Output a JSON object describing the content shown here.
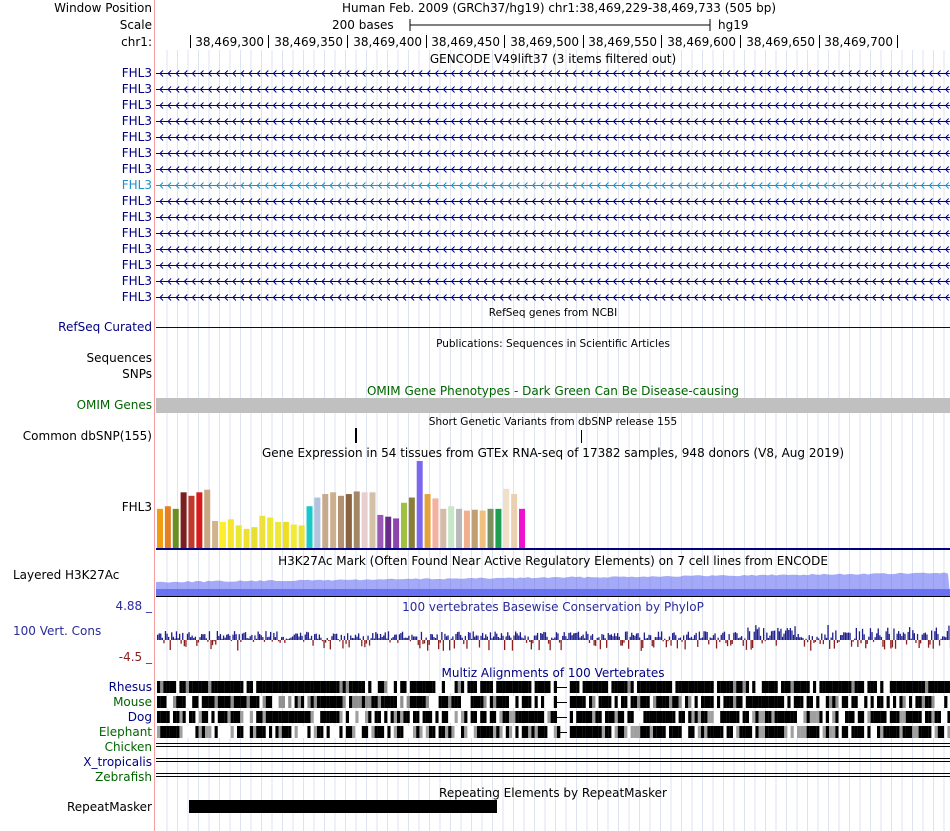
{
  "header": {
    "window_position_label": "Window Position",
    "scale_label": "Scale",
    "chrom_label": "chr1:",
    "assembly_text": "Human Feb. 2009 (GRCh37/hg19)   chr1:38,469,229-38,469,733 (505 bp)",
    "scale_text": "200 bases",
    "db": "hg19",
    "ticks": [
      "38,469,300",
      "38,469,350",
      "38,469,400",
      "38,469,450",
      "38,469,500",
      "38,469,550",
      "38,469,600",
      "38,469,650",
      "38,469,700"
    ]
  },
  "gencode": {
    "title": "GENCODE V49lift37 (3 items filtered out)",
    "gene_name": "FHL3",
    "rows": [
      {
        "name": "FHL3",
        "color": "#000080"
      },
      {
        "name": "FHL3",
        "color": "#000080"
      },
      {
        "name": "FHL3",
        "color": "#000080"
      },
      {
        "name": "FHL3",
        "color": "#000080"
      },
      {
        "name": "FHL3",
        "color": "#000080"
      },
      {
        "name": "FHL3",
        "color": "#000080"
      },
      {
        "name": "FHL3",
        "color": "#000080"
      },
      {
        "name": "FHL3",
        "color": "#1e90c8"
      },
      {
        "name": "FHL3",
        "color": "#000080"
      },
      {
        "name": "FHL3",
        "color": "#000080"
      },
      {
        "name": "FHL3",
        "color": "#000080"
      },
      {
        "name": "FHL3",
        "color": "#000080"
      },
      {
        "name": "FHL3",
        "color": "#000080"
      },
      {
        "name": "FHL3",
        "color": "#000080"
      },
      {
        "name": "FHL3",
        "color": "#000080"
      }
    ]
  },
  "refseq": {
    "title": "RefSeq genes from NCBI",
    "label": "RefSeq Curated"
  },
  "publications": {
    "title": "Publications: Sequences in Scientific Articles",
    "label_sequences": "Sequences",
    "label_snps": "SNPs"
  },
  "omim": {
    "title": "OMIM Gene Phenotypes - Dark Green Can Be Disease-causing",
    "label": "OMIM Genes",
    "color": "#006400"
  },
  "dbsnp": {
    "title": "Short Genetic Variants from dbSNP release 155",
    "label": "Common dbSNP(155)"
  },
  "gtex": {
    "title": "Gene Expression in 54 tissues from GTEx RNA-seq of 17382 samples, 948 donors (V8, Aug 2019)",
    "label": "FHL3",
    "colors": [
      "#f39c12",
      "#e67e22",
      "#6b8e23",
      "#7b1e1e",
      "#c0392b",
      "#d71a1a",
      "#c8a882",
      "#d2b48c",
      "#ffef2b",
      "#f5e52b",
      "#e8e830",
      "#f0e030",
      "#e8e030",
      "#eee040",
      "#ede830",
      "#f0e838",
      "#eedd20",
      "#f2ea38",
      "#ebe438",
      "#19c8c8",
      "#b0c4de",
      "#c7a98e",
      "#ccb090",
      "#b49070",
      "#8b6340",
      "#a38868",
      "#e8cfcf",
      "#d4c0a6",
      "#9b59b6",
      "#6a2c8c",
      "#8e44ad",
      "#a0c040",
      "#8b7d3a",
      "#7b68ee",
      "#e6a23c",
      "#f5b0a0",
      "#d4bca8",
      "#c8e6c8",
      "#b8b8b8",
      "#f0b090",
      "#c0a070",
      "#f0c080",
      "#7a9060",
      "#1e9e50",
      "#f0e0c8",
      "#e8d0b0",
      "#f010d0"
    ],
    "values": [
      0.45,
      0.48,
      0.45,
      0.64,
      0.6,
      0.64,
      0.67,
      0.31,
      0.3,
      0.33,
      0.26,
      0.22,
      0.24,
      0.37,
      0.35,
      0.3,
      0.3,
      0.27,
      0.26,
      0.48,
      0.58,
      0.62,
      0.64,
      0.6,
      0.62,
      0.65,
      0.64,
      0.64,
      0.38,
      0.36,
      0.34,
      0.52,
      0.58,
      1.0,
      0.62,
      0.57,
      0.45,
      0.48,
      0.45,
      0.43,
      0.44,
      0.43,
      0.45,
      0.45,
      0.68,
      0.62,
      0.45
    ]
  },
  "h3k27ac": {
    "title": "H3K27Ac Mark (Often Found Near Active Regulatory Elements) on 7 cell lines from ENCODE",
    "label": "Layered H3K27Ac",
    "color": "#5a64f0"
  },
  "phylop": {
    "title": "100 vertebrates Basewise Conservation by PhyloP",
    "label": "100 Vert. Cons",
    "max_label": "4.88 _",
    "min_label": "-4.5 _",
    "pos_color": "#1e1e8c",
    "neg_color": "#8c1e1e"
  },
  "multiz": {
    "title": "Multiz Alignments of 100 Vertebrates",
    "species": [
      {
        "name": "Rhesus",
        "color": "#000080"
      },
      {
        "name": "Mouse",
        "color": "#006400"
      },
      {
        "name": "Dog",
        "color": "#000080"
      },
      {
        "name": "Elephant",
        "color": "#006400"
      },
      {
        "name": "Chicken",
        "color": "#006400"
      },
      {
        "name": "X_tropicalis",
        "color": "#000080"
      },
      {
        "name": "Zebrafish",
        "color": "#006400"
      }
    ]
  },
  "repeatmasker": {
    "title": "Repeating Elements by RepeatMasker",
    "label": "RepeatMasker"
  }
}
